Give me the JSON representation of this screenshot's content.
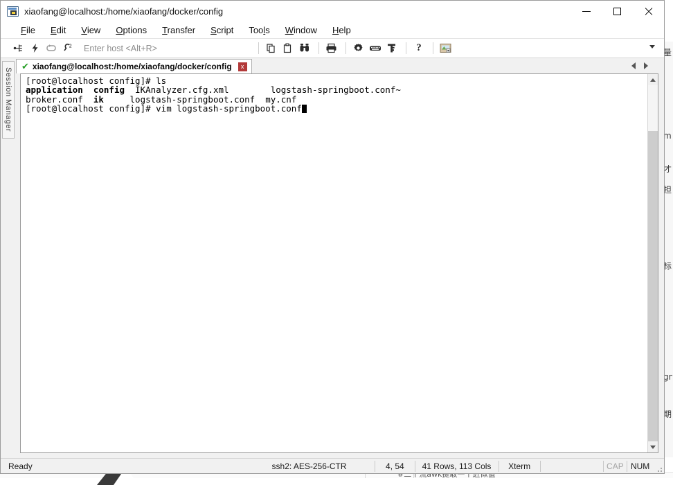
{
  "window": {
    "title": "xiaofang@localhost:/home/xiaofang/docker/config",
    "app_icon": "terminal-window-icon",
    "controls": {
      "minimize": "minimize-icon",
      "maximize": "maximize-icon",
      "close": "close-icon"
    }
  },
  "menubar": {
    "items": [
      {
        "label": "File",
        "accel": "F"
      },
      {
        "label": "Edit",
        "accel": "E"
      },
      {
        "label": "View",
        "accel": "V"
      },
      {
        "label": "Options",
        "accel": "O"
      },
      {
        "label": "Transfer",
        "accel": "T"
      },
      {
        "label": "Script",
        "accel": "S"
      },
      {
        "label": "Tools",
        "accel": "l"
      },
      {
        "label": "Window",
        "accel": "W"
      },
      {
        "label": "Help",
        "accel": "H"
      }
    ]
  },
  "toolbar": {
    "host_placeholder": "Enter host <Alt+R>",
    "icons": [
      "connect-icon",
      "quick-connect-icon",
      "reconnect-icon",
      "disconnect-icon"
    ],
    "icons2": [
      "copy-icon",
      "paste-icon",
      "find-icon"
    ],
    "icons3": [
      "print-icon"
    ],
    "icons4": [
      "settings-gear-icon",
      "keyboard-icon",
      "key-icon"
    ],
    "icons5": [
      "help-icon"
    ],
    "icons6": [
      "session-options-icon"
    ],
    "overflow": "toolbar-overflow-caret"
  },
  "sidebar": {
    "session_manager_label": "Session Manager"
  },
  "tabstrip": {
    "tab": {
      "status_icon": "connected-check-icon",
      "title": "xiaofang@localhost:/home/xiaofang/docker/config",
      "close_label": "x"
    },
    "nav_prev": "tab-prev-icon",
    "nav_next": "tab-next-icon"
  },
  "terminal": {
    "prompt": "[root@localhost config]#",
    "lines": [
      {
        "segments": [
          {
            "text": "[root@localhost config]# ls",
            "bold": false
          }
        ]
      },
      {
        "segments": [
          {
            "text": "application",
            "bold": true
          },
          {
            "text": "  ",
            "bold": false
          },
          {
            "text": "config",
            "bold": true
          },
          {
            "text": "  IKAnalyzer.cfg.xml        logstash-springboot.conf~",
            "bold": false
          }
        ]
      },
      {
        "segments": [
          {
            "text": "broker.conf  ",
            "bold": false
          },
          {
            "text": "ik",
            "bold": true
          },
          {
            "text": "     logstash-springboot.conf  my.cnf",
            "bold": false
          }
        ]
      },
      {
        "segments": [
          {
            "text": "[root@localhost config]# vim logstash-springboot.conf",
            "bold": false
          },
          {
            "text": "█",
            "bold": false,
            "cursor": true
          }
        ]
      }
    ],
    "scrollbar": {
      "up": "scroll-up-icon",
      "down": "scroll-down-icon"
    }
  },
  "statusbar": {
    "ready": "Ready",
    "cipher": "ssh2: AES-256-CTR",
    "cursor_pos": "4, 54",
    "dimensions": "41 Rows, 113 Cols",
    "emulation": "Xterm",
    "caps": "CAP",
    "num": "NUM"
  },
  "background": {
    "bottom_text": "#二个流awk提取一个近似值",
    "right_chars": [
      "量",
      "m",
      "才",
      "担",
      "标",
      "gn",
      "期"
    ]
  },
  "colors": {
    "accent_green": "#2aa02a",
    "tab_close_red": "#b33a3a",
    "terminal_fg": "#000000",
    "terminal_bg": "#ffffff"
  }
}
